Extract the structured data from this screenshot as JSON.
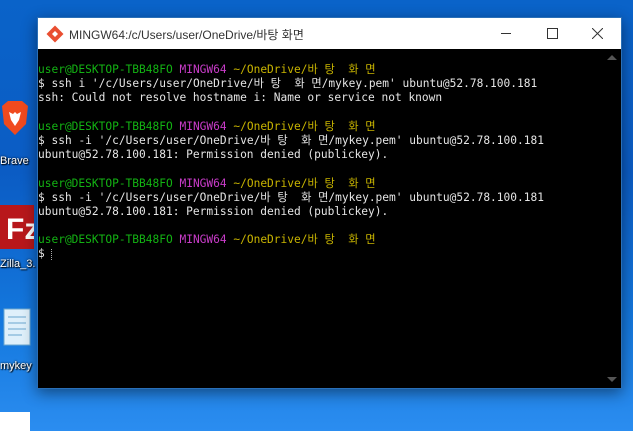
{
  "window": {
    "title": "MINGW64:/c/Users/user/OneDrive/바탕 화면"
  },
  "desktop_icons": [
    {
      "label": "Brave",
      "icon": "brave-lion-icon"
    },
    {
      "label": "Zilla_3.",
      "icon": "filezilla-icon"
    },
    {
      "label": "mykey",
      "icon": "notepad-file-icon"
    }
  ],
  "terminal": {
    "prompt_user": "user@DESKTOP-TBB48FO",
    "prompt_shell": "MINGW64",
    "prompt_path": "~/OneDrive/바 탕  화 면",
    "prompt_symbol": "$",
    "entries": [
      {
        "command": "ssh i '/c/Users/user/OneDrive/바 탕  화 면/mykey.pem' ubuntu@52.78.100.181",
        "output": "ssh: Could not resolve hostname i: Name or service not known"
      },
      {
        "command": "ssh -i '/c/Users/user/OneDrive/바 탕  화 면/mykey.pem' ubuntu@52.78.100.181",
        "output": "ubuntu@52.78.100.181: Permission denied (publickey)."
      },
      {
        "command": "ssh -i '/c/Users/user/OneDrive/바 탕  화 면/mykey.pem' ubuntu@52.78.100.181",
        "output": "ubuntu@52.78.100.181: Permission denied (publickey)."
      }
    ]
  },
  "colors": {
    "prompt_user": "#13b313",
    "prompt_shell": "#c93cc9",
    "prompt_path": "#c8b400",
    "terminal_bg": "#000000",
    "desktop_bg": "#0b5cc4"
  }
}
